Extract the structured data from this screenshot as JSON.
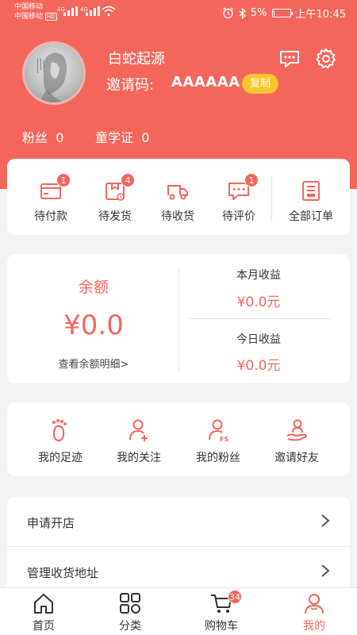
{
  "status_bar": {
    "carrier1": "中国移动",
    "carrier2": "中国移动",
    "hd": "HD",
    "net1": "4G",
    "net2": "4G",
    "battery_pct": "5%",
    "battery_level": 0.05,
    "time": "上午10:45"
  },
  "profile": {
    "username": "白蛇起源",
    "invite_label": "邀请码:",
    "invite_code": "AAAAAA",
    "copy_label": "复制",
    "fans_label": "粉丝",
    "fans_count": "0",
    "student_label": "童学证",
    "student_count": "0"
  },
  "orders": {
    "items": [
      {
        "label": "待付款",
        "badge": "1",
        "icon": "wallet-icon"
      },
      {
        "label": "待发货",
        "badge": "4",
        "icon": "package-icon"
      },
      {
        "label": "待收货",
        "badge": "",
        "icon": "truck-icon"
      },
      {
        "label": "待评价",
        "badge": "1",
        "icon": "comment-icon"
      }
    ],
    "all_label": "全部订单"
  },
  "balance": {
    "title": "余额",
    "value": "¥0.0",
    "detail_link": "查看余额明细>",
    "month_label": "本月收益",
    "month_value": "¥0.0元",
    "today_label": "今日收益",
    "today_value": "¥0.0元"
  },
  "social": {
    "items": [
      {
        "label": "我的足迹",
        "icon": "footprint-icon"
      },
      {
        "label": "我的关注",
        "icon": "follow-user-icon"
      },
      {
        "label": "我的粉丝",
        "icon": "fans-user-icon"
      },
      {
        "label": "邀请好友",
        "icon": "invite-friend-icon"
      }
    ]
  },
  "menu": {
    "items": [
      {
        "label": "申请开店"
      },
      {
        "label": "管理收货地址"
      }
    ]
  },
  "tabbar": {
    "items": [
      {
        "label": "首页",
        "icon": "home-icon"
      },
      {
        "label": "分类",
        "icon": "category-icon"
      },
      {
        "label": "购物车",
        "icon": "cart-icon",
        "badge": "34"
      },
      {
        "label": "我的",
        "icon": "user-icon",
        "active": true
      }
    ]
  },
  "colors": {
    "brand": "#f4665b",
    "copy_button": "#f7c62e",
    "background": "#f3f3f3"
  }
}
